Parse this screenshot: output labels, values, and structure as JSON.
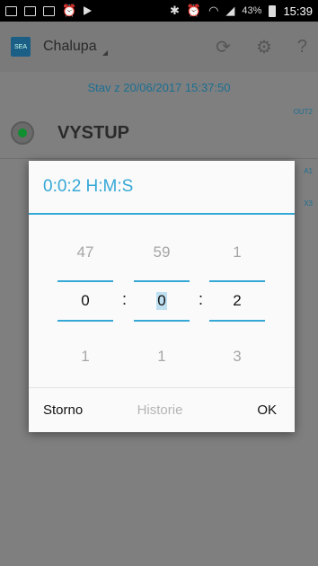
{
  "status_bar": {
    "battery_percent": "43%",
    "time": "15:39",
    "left_icons": [
      "mail-icon",
      "image-icon",
      "gallery-icon",
      "alarm-icon",
      "play-icon"
    ],
    "right_icons": [
      "bluetooth-icon",
      "alarm-icon",
      "wifi-icon",
      "signal-icon",
      "battery-icon"
    ]
  },
  "app_bar": {
    "title": "Chalupa",
    "logo_text": "SEA",
    "actions": [
      "refresh-icon",
      "settings-icon",
      "help-icon"
    ],
    "help_label": "?"
  },
  "subtitle": "Stav z 20/06/2017 15:37:50",
  "rows": [
    {
      "name": "VYSTUP",
      "tag": "OUT2"
    },
    {
      "name": "",
      "tag": "A1"
    },
    {
      "name": "",
      "tag": "X3"
    }
  ],
  "dialog": {
    "title": "0:0:2 H:M:S",
    "hours": {
      "prev": "47",
      "current": "0",
      "next": "1"
    },
    "minutes": {
      "prev": "59",
      "current": "0",
      "next": "1"
    },
    "seconds": {
      "prev": "1",
      "current": "2",
      "next": "3"
    },
    "separator": ":",
    "buttons": {
      "cancel": "Storno",
      "history": "Historie",
      "ok": "OK"
    }
  },
  "colors": {
    "accent": "#35a8d6",
    "text_disabled": "#b5b5b5"
  }
}
